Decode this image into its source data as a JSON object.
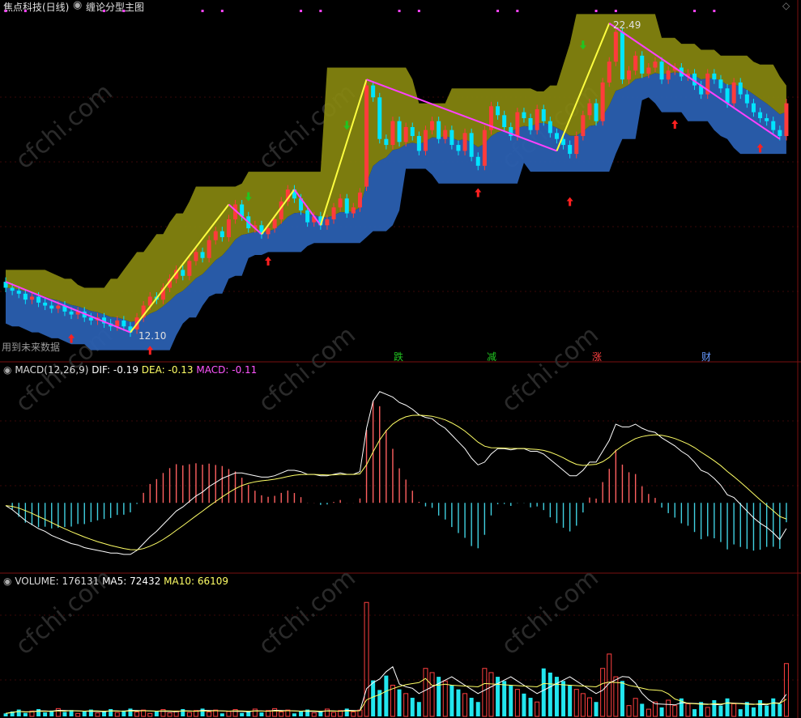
{
  "header": {
    "stock_title": "焦点科技(日线)",
    "indicator_name": "缠论分型主图",
    "circle_icon": "info-circle-icon",
    "diamond_icon": "diamond-icon"
  },
  "main_panel": {
    "note": "用到未来数据",
    "low_label": "12.10",
    "high_label": "22.49",
    "signals": [
      "跌",
      "减",
      "涨",
      "财"
    ],
    "signal_colors": [
      "#21c521",
      "#21c521",
      "#ff4040",
      "#6699ff"
    ]
  },
  "macd_panel": {
    "label": "MACD(12,26,9)",
    "dif_label": "DIF:",
    "dif_value": "-0.19",
    "dea_label": "DEA:",
    "dea_value": "-0.13",
    "macd_label": "MACD:",
    "macd_value": "-0.11"
  },
  "volume_panel": {
    "label": "VOLUME:",
    "value": "176131",
    "ma5_label": "MA5:",
    "ma5_value": "72432",
    "ma10_label": "MA10:",
    "ma10_value": "66109"
  },
  "watermark": "cfchi.com",
  "colors": {
    "up": "#ff3b3b",
    "down": "#00e5ff",
    "dif": "#ffffff",
    "dea": "#ffff66",
    "band_upper": "#8a8a10",
    "band_lower": "#2a5fb0",
    "bi_up": "#ffff40",
    "bi_down": "#ff40ff"
  },
  "chart_data": [
    {
      "type": "candlestick",
      "title": "缠论分型主图",
      "n_bars": 120,
      "close": [
        13.6,
        13.5,
        13.4,
        13.2,
        13.3,
        13.1,
        13.0,
        12.9,
        13.0,
        12.8,
        12.7,
        12.8,
        12.6,
        12.5,
        12.6,
        12.4,
        12.3,
        12.5,
        12.3,
        12.1,
        12.6,
        13.0,
        13.3,
        13.2,
        13.6,
        13.9,
        14.2,
        14.0,
        14.5,
        14.8,
        14.6,
        15.2,
        15.5,
        15.3,
        15.9,
        16.4,
        16.0,
        15.6,
        15.7,
        15.4,
        15.6,
        15.9,
        16.5,
        16.9,
        16.6,
        16.2,
        15.8,
        16.0,
        15.7,
        15.9,
        16.3,
        16.6,
        16.1,
        16.3,
        16.8,
        20.4,
        20.0,
        18.6,
        18.4,
        19.2,
        18.5,
        19.0,
        18.7,
        18.2,
        18.9,
        19.2,
        18.6,
        18.9,
        18.4,
        18.2,
        18.8,
        18.0,
        17.7,
        18.9,
        19.7,
        19.4,
        19.0,
        18.7,
        19.5,
        19.3,
        18.9,
        19.6,
        19.2,
        18.8,
        18.6,
        18.4,
        18.1,
        18.7,
        19.4,
        19.8,
        19.2,
        20.5,
        21.2,
        22.2,
        20.6,
        20.9,
        21.4,
        20.8,
        21.0,
        21.2,
        20.6,
        20.9,
        21.0,
        20.7,
        20.8,
        20.4,
        20.1,
        20.8,
        20.6,
        20.3,
        19.8,
        20.5,
        20.1,
        19.8,
        19.5,
        19.3,
        19.2,
        18.9,
        18.7,
        19.8
      ],
      "open": [
        13.8,
        13.6,
        13.5,
        13.4,
        13.2,
        13.3,
        13.1,
        13.0,
        12.9,
        13.0,
        12.8,
        12.7,
        12.8,
        12.6,
        12.5,
        12.6,
        12.4,
        12.3,
        12.5,
        12.3,
        12.2,
        12.6,
        13.0,
        13.3,
        13.2,
        13.6,
        13.9,
        14.2,
        14.0,
        14.5,
        14.8,
        14.6,
        15.2,
        15.5,
        15.3,
        15.9,
        16.4,
        16.0,
        15.6,
        15.7,
        15.4,
        15.6,
        15.9,
        16.5,
        16.9,
        16.6,
        16.2,
        15.8,
        16.0,
        15.7,
        15.9,
        16.3,
        16.6,
        16.1,
        16.3,
        17.0,
        20.4,
        20.0,
        18.6,
        18.4,
        19.2,
        18.5,
        19.0,
        18.7,
        18.2,
        18.9,
        19.2,
        18.6,
        18.9,
        18.4,
        18.2,
        18.8,
        18.0,
        17.7,
        18.9,
        19.7,
        19.4,
        19.0,
        18.7,
        19.5,
        19.3,
        18.9,
        19.6,
        19.2,
        18.8,
        18.6,
        18.4,
        18.1,
        18.7,
        19.4,
        19.8,
        19.2,
        20.5,
        21.2,
        22.2,
        20.6,
        20.9,
        21.4,
        20.8,
        21.0,
        21.2,
        20.6,
        20.9,
        21.0,
        20.7,
        20.8,
        20.4,
        20.1,
        20.8,
        20.6,
        20.3,
        19.8,
        20.5,
        20.1,
        19.8,
        19.5,
        19.3,
        19.2,
        18.9,
        18.7
      ],
      "low_point": 12.1,
      "high_point": 22.49,
      "ylim": [
        11.3,
        23.0
      ]
    },
    {
      "type": "bar+line",
      "title": "MACD(12,26,9)",
      "dif_last": -0.19,
      "dea_last": -0.13,
      "macd_last": -0.11,
      "dif": [
        -0.02,
        -0.05,
        -0.09,
        -0.13,
        -0.16,
        -0.19,
        -0.21,
        -0.24,
        -0.26,
        -0.28,
        -0.3,
        -0.31,
        -0.33,
        -0.34,
        -0.35,
        -0.36,
        -0.37,
        -0.37,
        -0.38,
        -0.38,
        -0.35,
        -0.3,
        -0.25,
        -0.21,
        -0.16,
        -0.11,
        -0.06,
        -0.03,
        0.01,
        0.05,
        0.08,
        0.12,
        0.15,
        0.18,
        0.2,
        0.22,
        0.22,
        0.21,
        0.2,
        0.19,
        0.19,
        0.2,
        0.22,
        0.24,
        0.24,
        0.23,
        0.21,
        0.21,
        0.2,
        0.2,
        0.21,
        0.22,
        0.21,
        0.21,
        0.23,
        0.55,
        0.75,
        0.82,
        0.8,
        0.78,
        0.74,
        0.72,
        0.69,
        0.65,
        0.63,
        0.62,
        0.58,
        0.55,
        0.5,
        0.45,
        0.4,
        0.33,
        0.28,
        0.3,
        0.36,
        0.4,
        0.4,
        0.39,
        0.4,
        0.4,
        0.38,
        0.38,
        0.36,
        0.32,
        0.28,
        0.24,
        0.2,
        0.2,
        0.24,
        0.3,
        0.3,
        0.38,
        0.46,
        0.58,
        0.56,
        0.56,
        0.58,
        0.55,
        0.53,
        0.52,
        0.48,
        0.45,
        0.42,
        0.38,
        0.35,
        0.3,
        0.24,
        0.22,
        0.18,
        0.13,
        0.06,
        0.04,
        -0.01,
        -0.06,
        -0.11,
        -0.15,
        -0.18,
        -0.22,
        -0.27,
        -0.19
      ],
      "ylim": [
        -0.5,
        0.95
      ]
    },
    {
      "type": "bar+line",
      "title": "VOLUME",
      "volume_last": 176131,
      "ma5_last": 72432,
      "ma10_last": 66109,
      "ylim": [
        0,
        1100000
      ]
    }
  ]
}
